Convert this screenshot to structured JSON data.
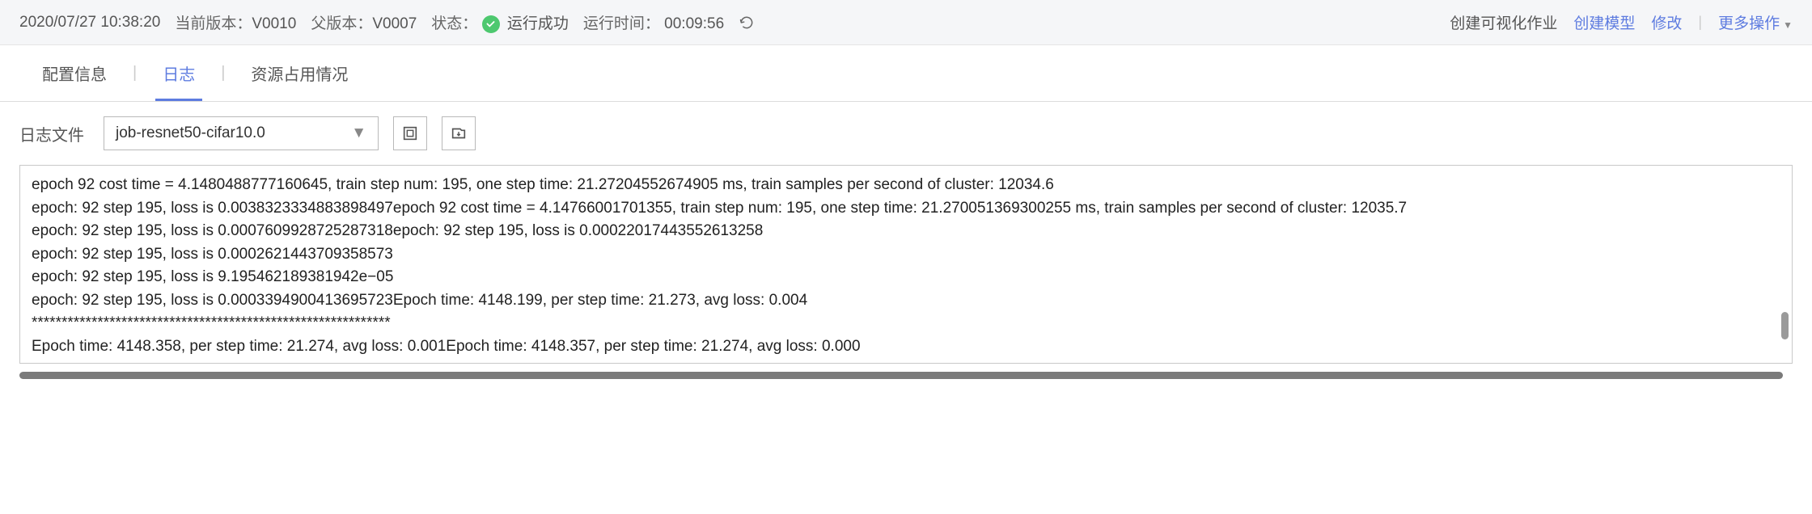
{
  "header": {
    "timestamp": "2020/07/27 10:38:20",
    "current_version_label": "当前版本：",
    "current_version": "V0010",
    "parent_version_label": "父版本：",
    "parent_version": "V0007",
    "status_label": "状态：",
    "status_text": "运行成功",
    "runtime_label": "运行时间：",
    "runtime": "00:09:56"
  },
  "actions": {
    "create_visual": "创建可视化作业",
    "create_model": "创建模型",
    "modify": "修改",
    "more": "更多操作"
  },
  "tabs": {
    "config": "配置信息",
    "logs": "日志",
    "resources": "资源占用情况"
  },
  "log_controls": {
    "label": "日志文件",
    "selected_file": "job-resnet50-cifar10.0"
  },
  "log_lines": [
    "epoch 92 cost time = 4.1480488777160645, train step num: 195, one step time: 21.27204552674905 ms, train samples per second of cluster: 12034.6",
    "epoch: 92 step 195, loss is 0.0038323334883898497epoch 92 cost time = 4.14766001701355, train step num: 195, one step time: 21.270051369300255 ms, train samples per second of cluster: 12035.7",
    "epoch: 92 step 195, loss is 0.000760992872528731­8epoch: 92 step 195, loss is 0.00022017443552613258",
    "epoch: 92 step 195, loss is 0.0002621443709358573",
    "epoch: 92 step 195, loss is 9.195462189381942e−05",
    "epoch: 92 step 195, loss is 0.0003394900413695723Epoch time: 4148.199, per step time: 21.273, avg loss: 0.004",
    "************************************************************",
    "Epoch time: 4148.358, per step time: 21.274, avg loss: 0.001Epoch time: 4148.357, per step time: 21.274, avg loss: 0.000"
  ]
}
